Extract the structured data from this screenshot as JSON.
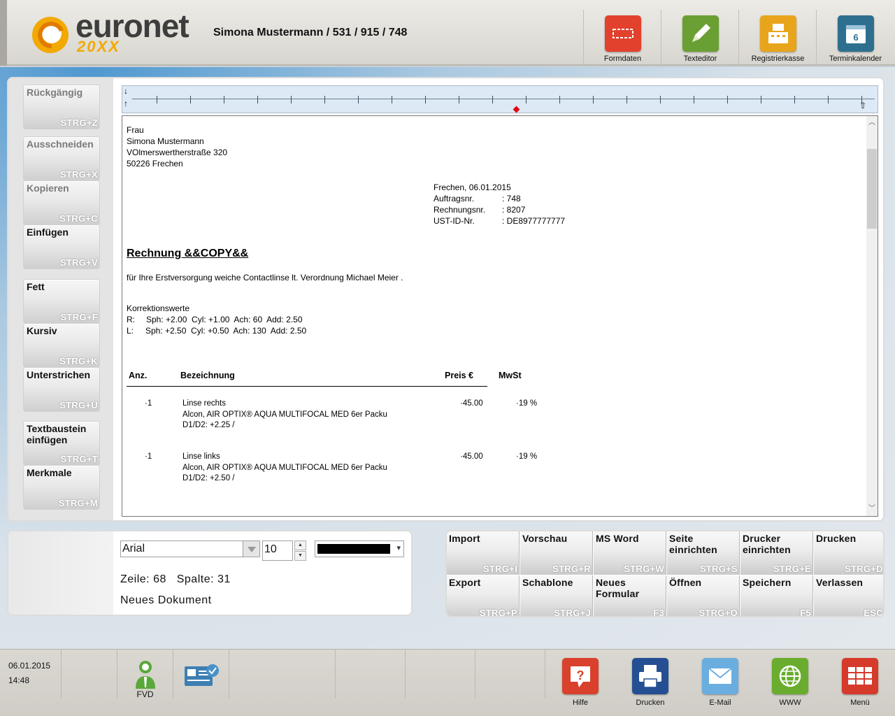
{
  "header": {
    "brand": "euronet",
    "brand_sub": "20XX",
    "customer": "Simona Mustermann / 531 / 915 / 748",
    "buttons": [
      {
        "label": "Formdaten",
        "icon": "form-data-icon",
        "color": "#e2412e"
      },
      {
        "label": "Texteditor",
        "icon": "pencil-icon",
        "color": "#6aa033"
      },
      {
        "label": "Registrierkasse",
        "icon": "cash-register-icon",
        "color": "#e8a51c"
      },
      {
        "label": "Terminkalender",
        "icon": "calendar-icon",
        "color": "#2e6f8f",
        "badge": "6"
      }
    ]
  },
  "edit_buttons": [
    {
      "label": "Rückgängig",
      "shortcut": "STRG+Z",
      "enabled": false
    },
    {
      "label": "Ausschneiden",
      "shortcut": "STRG+X",
      "enabled": false
    },
    {
      "label": "Kopieren",
      "shortcut": "STRG+C",
      "enabled": false
    },
    {
      "label": "Einfügen",
      "shortcut": "STRG+V",
      "enabled": true
    },
    {
      "label": "Fett",
      "shortcut": "STRG+F",
      "enabled": true
    },
    {
      "label": "Kursiv",
      "shortcut": "STRG+K",
      "enabled": true
    },
    {
      "label": "Unterstrichen",
      "shortcut": "STRG+U",
      "enabled": true
    },
    {
      "label": "Textbaustein einfügen",
      "shortcut": "STRG+T",
      "enabled": true
    },
    {
      "label": "Merkmale",
      "shortcut": "STRG+M",
      "enabled": true
    }
  ],
  "document": {
    "address": [
      "Frau",
      "Simona Mustermann",
      "VOlmerswertherstraße 320",
      "50226 Frechen"
    ],
    "date_line": "Frechen, 06.01.2015",
    "meta": [
      {
        "label": "Auftragsnr.",
        "value": ": 748"
      },
      {
        "label": "Rechnungsnr.",
        "value": ": 8207"
      },
      {
        "label": "UST-ID-Nr.",
        "value": ": DE8977777777"
      }
    ],
    "title": "Rechnung &&COPY&&",
    "intro": "für Ihre Erstversorgung weiche Contactlinse lt. Verordnung Michael Meier .",
    "korr_heading": "Korrektionswerte",
    "korr_rows": [
      {
        "side": "R:",
        "values": "Sph: +2.00  Cyl: +1.00  Ach: 60  Add: 2.50"
      },
      {
        "side": "L:",
        "values": "Sph: +2.50  Cyl: +0.50  Ach: 130  Add: 2.50"
      }
    ],
    "table_headers": {
      "qty": "Anz.",
      "desc": "Bezeichnung",
      "price": "Preis €",
      "vat": "MwSt"
    },
    "items": [
      {
        "qty": "·1",
        "name": "Linse rechts",
        "detail": "Alcon, AIR OPTIX® AQUA MULTIFOCAL MED 6er Packu",
        "power": "D1/D2: +2.25 /",
        "price": "·45.00",
        "vat": "·19 %"
      },
      {
        "qty": "·1",
        "name": "Linse links",
        "detail": "Alcon, AIR OPTIX® AQUA MULTIFOCAL MED 6er Packu",
        "power": "D1/D2: +2.50 /",
        "price": "·45.00",
        "vat": "·19 %"
      }
    ]
  },
  "format": {
    "font": "Arial",
    "size": "10",
    "color": "#000000",
    "zeile_label": "Zeile:",
    "zeile": "68",
    "spalte_label": "Spalte:",
    "spalte": "31",
    "doc_name": "Neues Dokument"
  },
  "actions": [
    {
      "label": "Import",
      "shortcut": "STRG+I"
    },
    {
      "label": "Vorschau",
      "shortcut": "STRG+R"
    },
    {
      "label": "MS Word",
      "shortcut": "STRG+W"
    },
    {
      "label": "Seite einrichten",
      "shortcut": "STRG+S"
    },
    {
      "label": "Drucker einrichten",
      "shortcut": "STRG+E"
    },
    {
      "label": "Drucken",
      "shortcut": "STRG+D"
    },
    {
      "label": "Export",
      "shortcut": "STRG+P"
    },
    {
      "label": "Schablone",
      "shortcut": "STRG+J"
    },
    {
      "label": "Neues Formular",
      "shortcut": "F3"
    },
    {
      "label": "Öffnen",
      "shortcut": "STRG+O"
    },
    {
      "label": "Speichern",
      "shortcut": "F5"
    },
    {
      "label": "Verlassen",
      "shortcut": "ESC"
    }
  ],
  "footer": {
    "date": "06.01.2015",
    "time": "14:48",
    "fvd_label": "FVD",
    "buttons": [
      {
        "label": "Hilfe",
        "icon": "help-icon",
        "color": "#d9412c"
      },
      {
        "label": "Drucken",
        "icon": "printer-icon",
        "color": "#254f93"
      },
      {
        "label": "E-Mail",
        "icon": "envelope-icon",
        "color": "#6aaee0"
      },
      {
        "label": "WWW",
        "icon": "globe-icon",
        "color": "#6aad2e"
      },
      {
        "label": "Menü",
        "icon": "menu-grid-icon",
        "color": "#d63a2b"
      }
    ]
  }
}
